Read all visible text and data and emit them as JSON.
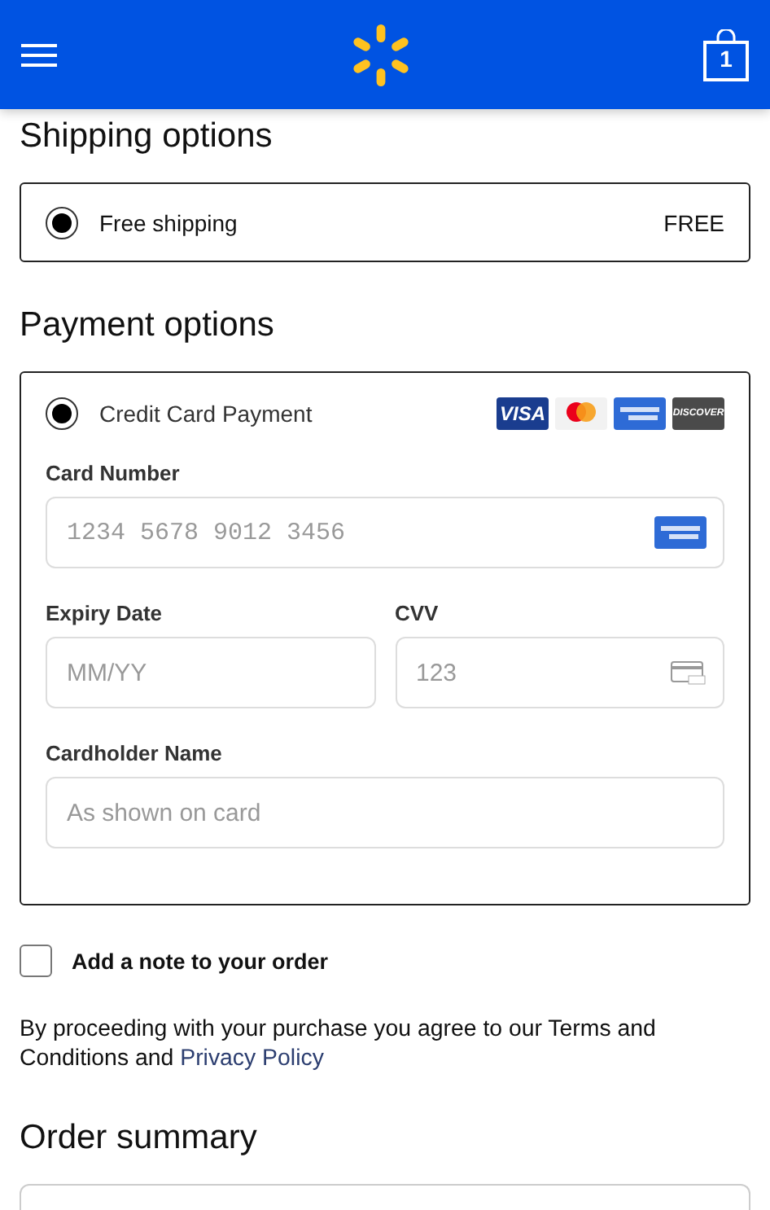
{
  "header": {
    "cart_count": "1"
  },
  "shipping": {
    "title": "Shipping options",
    "options": [
      {
        "label": "Free shipping",
        "price": "FREE",
        "selected": true
      }
    ]
  },
  "payment": {
    "title": "Payment options",
    "method": {
      "label": "Credit Card Payment",
      "selected": true
    },
    "cards": [
      {
        "kind": "visa",
        "label": "VISA"
      },
      {
        "kind": "mastercard"
      },
      {
        "kind": "amex"
      },
      {
        "kind": "discover",
        "label": "DISCOVER"
      }
    ],
    "fields": [
      {
        "label": "Card Number",
        "placeholder": "1234 5678 9012 3456",
        "kind": "card"
      },
      {
        "label": "Expiry Date",
        "placeholder": "MM/YY",
        "kind": "plain"
      },
      {
        "label": "CVV",
        "placeholder": "123",
        "kind": "cvv"
      },
      {
        "label": "Cardholder Name",
        "placeholder": "As shown on card",
        "kind": "plain"
      }
    ]
  },
  "note": {
    "label": "Add a note to your order",
    "checked": false
  },
  "terms": {
    "text": "By proceeding with your purchase you agree to our Terms and Conditions and",
    "link": "Privacy Policy"
  },
  "summary": {
    "title": "Order summary"
  }
}
